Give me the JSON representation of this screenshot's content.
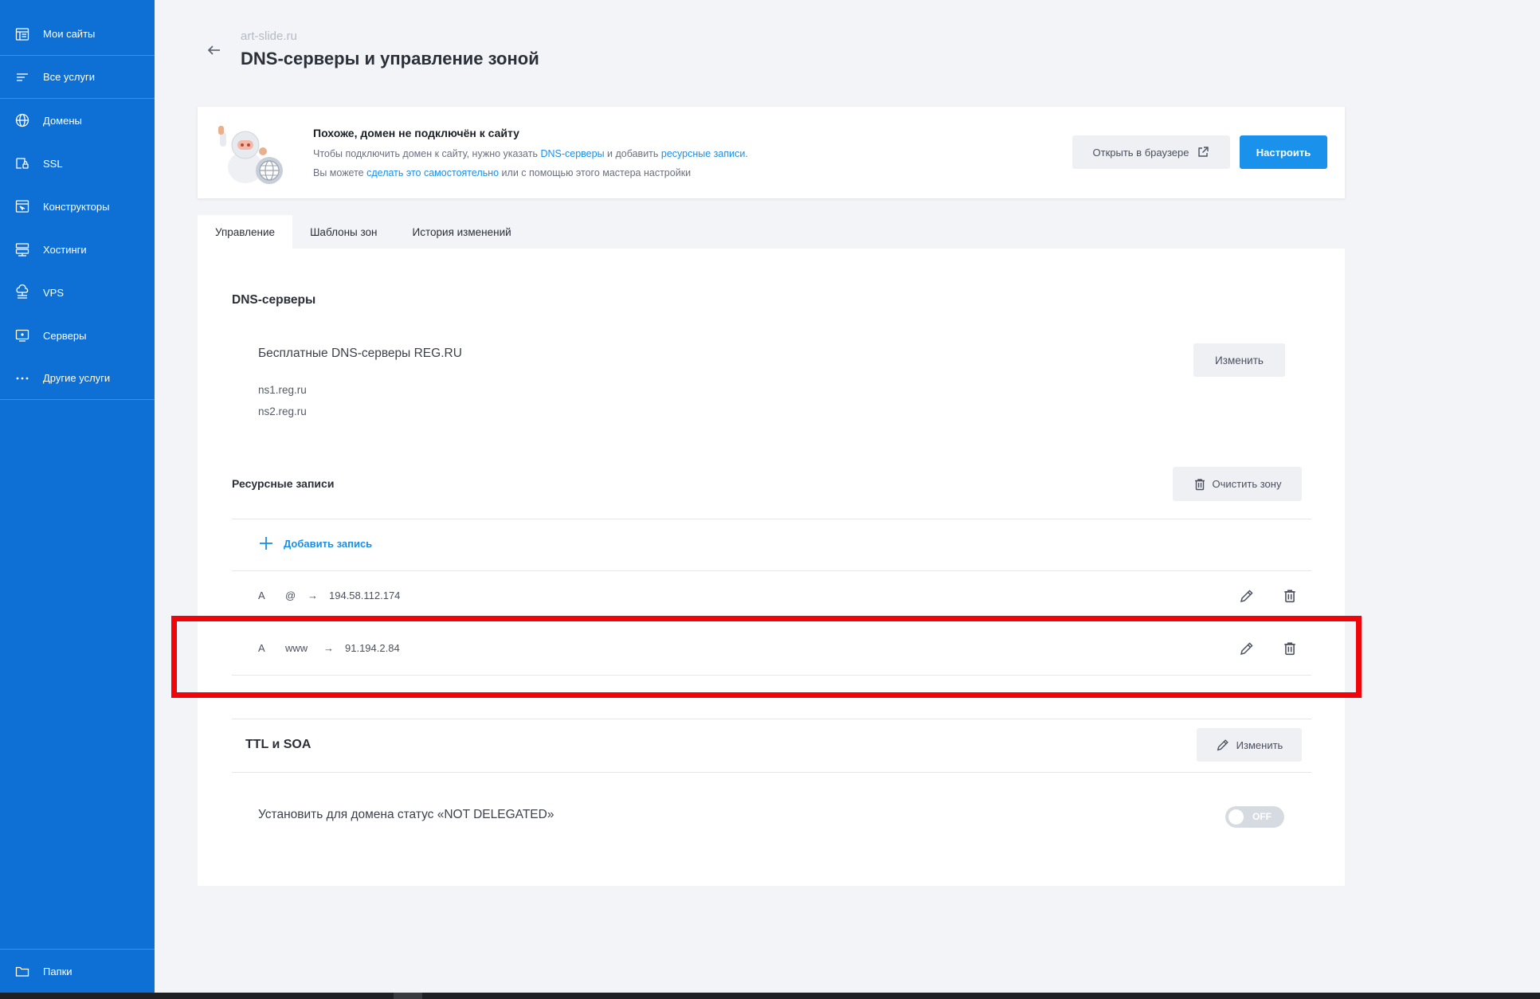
{
  "sidebar": {
    "items": [
      {
        "label": "Мои сайты",
        "icon": "sites-icon"
      },
      {
        "label": "Все услуги",
        "icon": "services-list-icon"
      },
      {
        "label": "Домены",
        "icon": "globe-icon"
      },
      {
        "label": "SSL",
        "icon": "ssl-lock-icon"
      },
      {
        "label": "Конструкторы",
        "icon": "builder-icon"
      },
      {
        "label": "Хостинги",
        "icon": "hosting-icon"
      },
      {
        "label": "VPS",
        "icon": "vps-cloud-icon"
      },
      {
        "label": "Серверы",
        "icon": "server-icon"
      },
      {
        "label": "Другие услуги",
        "icon": "more-dots-icon"
      }
    ],
    "folders_label": "Папки"
  },
  "header": {
    "domain": "art-slide.ru",
    "title": "DNS-серверы и управление зоной"
  },
  "banner": {
    "title": "Похоже, домен не подключён к сайту",
    "line1_prefix": "Чтобы подключить домен к сайту, нужно указать ",
    "line1_link1": "DNS-серверы",
    "line1_middle": " и добавить ",
    "line1_link2": "ресурсные записи",
    "line1_suffix": ".",
    "line2_prefix": "Вы можете ",
    "line2_link": "сделать это самостоятельно",
    "line2_suffix": " или с помощью этого мастера настройки",
    "open_browser_label": "Открыть в браузере",
    "configure_label": "Настроить"
  },
  "tabs": [
    {
      "label": "Управление",
      "active": true
    },
    {
      "label": "Шаблоны зон",
      "active": false
    },
    {
      "label": "История изменений",
      "active": false
    }
  ],
  "dns": {
    "section_title": "DNS-серверы",
    "provider": "Бесплатные DNS-серверы REG.RU",
    "servers": [
      "ns1.reg.ru",
      "ns2.reg.ru"
    ],
    "change_label": "Изменить"
  },
  "records": {
    "section_title": "Ресурсные записи",
    "clear_zone_label": "Очистить зону",
    "add_label": "Добавить запись",
    "arrow": "→",
    "rows": [
      {
        "type": "A",
        "host": "@",
        "value": "194.58.112.174"
      },
      {
        "type": "A",
        "host": "www",
        "value": "91.194.2.84"
      }
    ]
  },
  "ttl": {
    "title": "TTL и SOA",
    "change_label": "Изменить"
  },
  "status": {
    "label": "Установить для домена статус «NOT DELEGATED»",
    "toggle_label": "OFF",
    "toggle_on": false
  },
  "colors": {
    "sidebar": "#0e6fd4",
    "accent": "#1a92ec",
    "highlight": "#f0060a"
  }
}
